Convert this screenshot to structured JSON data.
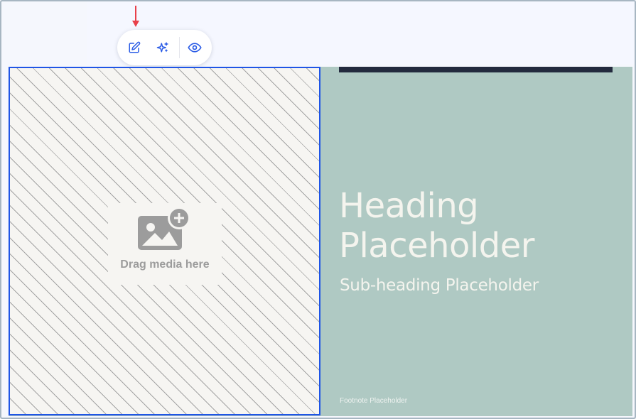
{
  "toolbar": {
    "buttons": [
      {
        "icon": "edit-icon",
        "label": "Edit"
      },
      {
        "icon": "ai-sparkle-icon",
        "label": "AI"
      },
      {
        "icon": "eye-icon",
        "label": "Preview"
      }
    ]
  },
  "annotation": {
    "icon": "arrow-down-icon",
    "color": "#e8404a"
  },
  "slide": {
    "media_placeholder": {
      "icon": "add-image-icon",
      "label": "Drag media here"
    },
    "heading": "Heading Placeholder",
    "subheading": "Sub-heading Placeholder",
    "footnote": "Footnote Placeholder",
    "colors": {
      "background": "#afc9c3",
      "topbar": "#232a3e",
      "selection": "#1f55e6",
      "text": "#f4f4ee"
    }
  }
}
